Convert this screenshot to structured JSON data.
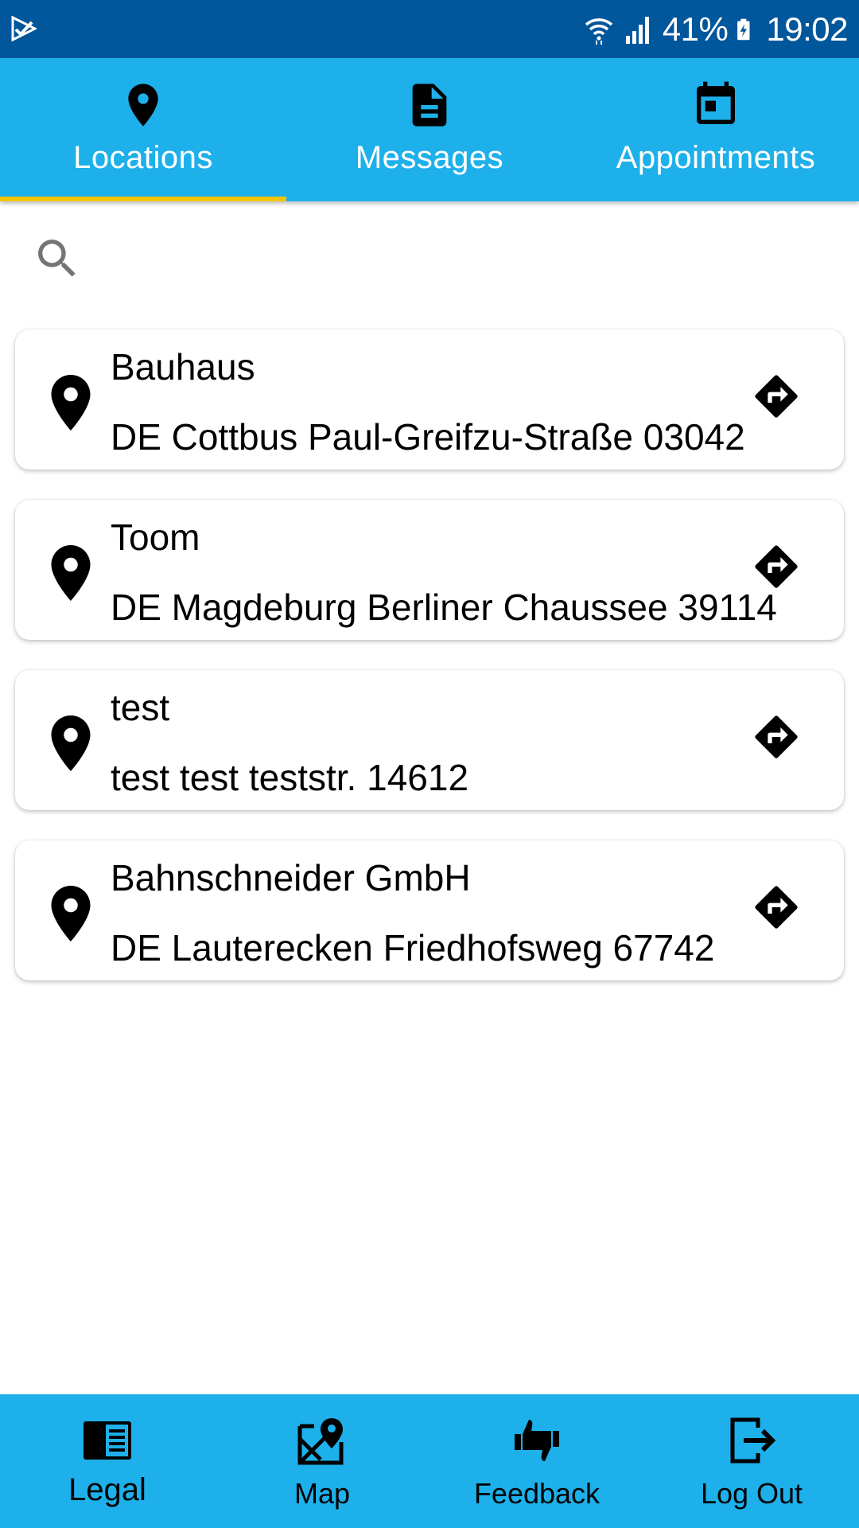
{
  "status_bar": {
    "app_icon": "check-triangle-icon",
    "battery": "41%",
    "time": "19:02"
  },
  "tabs": [
    {
      "label": "Locations",
      "icon": "location-pin-icon",
      "selected": true
    },
    {
      "label": "Messages",
      "icon": "document-icon",
      "selected": false
    },
    {
      "label": "Appointments",
      "icon": "calendar-icon",
      "selected": false
    }
  ],
  "search": {
    "placeholder": "",
    "value": ""
  },
  "locations": [
    {
      "name": "Bauhaus",
      "address": "DE Cottbus Paul-Greifzu-Straße 03042"
    },
    {
      "name": "Toom",
      "address": "DE Magdeburg Berliner Chaussee 39114"
    },
    {
      "name": "test",
      "address": "test test teststr. 14612"
    },
    {
      "name": "Bahnschneider GmbH",
      "address": "DE Lauterecken Friedhofsweg 67742"
    }
  ],
  "bottom_nav": [
    {
      "label": "Legal",
      "icon": "legal-book-icon"
    },
    {
      "label": "Map",
      "icon": "map-icon"
    },
    {
      "label": "Feedback",
      "icon": "thumbs-feedback-icon"
    },
    {
      "label": "Log Out",
      "icon": "logout-icon"
    }
  ],
  "colors": {
    "status_bar": "#01579b",
    "primary": "#1eb0ea",
    "tab_indicator": "#f5c400",
    "card_background": "#ffffff"
  }
}
